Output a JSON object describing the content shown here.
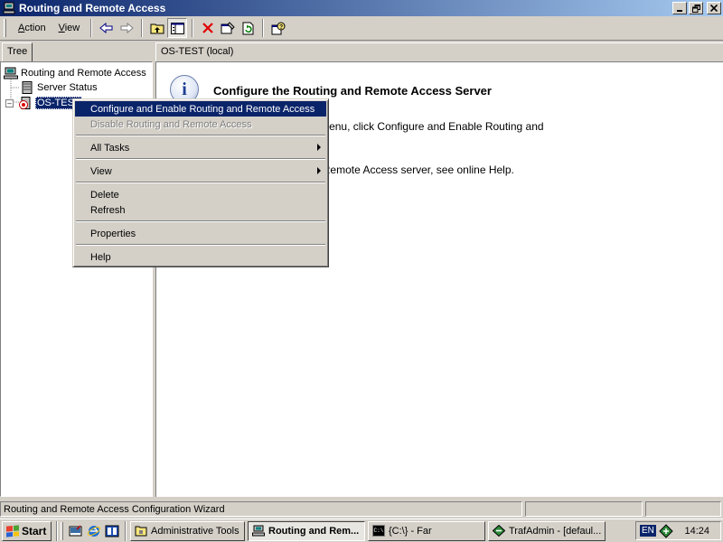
{
  "window": {
    "title": "Routing and Remote Access"
  },
  "menubar": {
    "action": "Action",
    "action_ul": "A",
    "action_rest": "ction",
    "view": "View",
    "view_ul": "V",
    "view_rest": "iew"
  },
  "toolbar_icons": [
    "back-arrow-icon",
    "forward-arrow-icon",
    "up-folder-icon",
    "show-hide-tree-icon",
    "delete-icon",
    "properties-icon",
    "refresh-icon",
    "help-icon"
  ],
  "tree": {
    "tab_label": "Tree",
    "items": [
      {
        "label": "Routing and Remote Access",
        "icon": "computer-network-icon"
      },
      {
        "label": "Server Status",
        "icon": "server-status-icon"
      },
      {
        "label": "OS-TEST",
        "icon": "server-stopped-icon",
        "selected": true,
        "expander": "⊟"
      }
    ]
  },
  "content": {
    "header": "OS-TEST (local)",
    "icon": "info-icon",
    "heading": "Configure the Routing and Remote Access Server",
    "line1": "Access, on the Action menu, click Configure and Enable Routing and",
    "line2": "tting up a Routing and Remote Access server, see online Help."
  },
  "context_menu": {
    "items": [
      {
        "label": "Configure and Enable Routing and Remote Access",
        "highlighted": true
      },
      {
        "label": "Disable Routing and Remote Access",
        "disabled": true
      },
      {
        "label": "All Tasks",
        "submenu": true
      },
      {
        "label": "View",
        "submenu": true
      },
      {
        "label": "Delete"
      },
      {
        "label": "Refresh"
      },
      {
        "label": "Properties"
      },
      {
        "label": "Help"
      }
    ]
  },
  "statusbar": {
    "text": "Routing and Remote Access Configuration Wizard"
  },
  "taskbar": {
    "start": "Start",
    "quick_launch": [
      "show-desktop-icon",
      "internet-explorer-icon",
      "outlook-express-icon"
    ],
    "buttons": [
      {
        "label": "Administrative Tools",
        "icon": "folder-icon"
      },
      {
        "label": "Routing and Rem...",
        "icon": "routing-icon",
        "active": true
      },
      {
        "label": "{C:\\} - Far",
        "icon": "console-icon"
      },
      {
        "label": "TrafAdmin - [defaul...",
        "icon": "trafadmin-icon"
      }
    ],
    "language": "EN",
    "clock": "14:24"
  },
  "colors": {
    "titlebar_start": "#0a246a",
    "titlebar_end": "#a6caf0",
    "highlight": "#0a246a",
    "face": "#d4d0c8"
  }
}
